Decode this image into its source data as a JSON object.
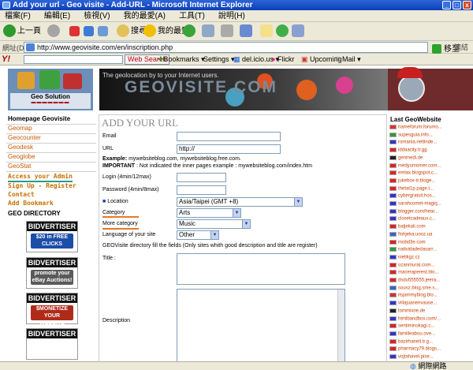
{
  "window": {
    "title": "Add your url - Geo visite - Add-URL - Microsoft Internet Explorer",
    "minimize": "_",
    "maximize": "□",
    "close": "x"
  },
  "menu": [
    "檔案(F)",
    "編輯(E)",
    "檢視(V)",
    "我的最愛(A)",
    "工具(T)",
    "說明(H)"
  ],
  "toolbar": {
    "back": "上一頁",
    "search": "搜尋",
    "favorites": "我的最愛"
  },
  "address": {
    "label": "網址(D)",
    "url": "http://www.geovisite.com/en/inscription.php",
    "go": "移至",
    "links": "連結"
  },
  "yahoo_bar": {
    "logo": "Y!",
    "search_button": "Web Search",
    "items": [
      "Bookmarks",
      "Settings",
      "del.icio.us",
      "Flickr",
      "Upcoming",
      "Mail"
    ]
  },
  "site": {
    "tagline": "The geolocation by to your Internet users.",
    "logo_text": "GEOVISITE.COM",
    "solution_caption": "Geo Solution"
  },
  "sidebar": {
    "section_title": "Homepage Geovisite",
    "nav": [
      "Geomap",
      "Geocounter",
      "Geodesk",
      "Geoglobe",
      "GeoStat"
    ],
    "account": [
      "Access your Admin",
      "Sign Up - Register",
      "Contact",
      "Add Bookmark"
    ],
    "directory_title": "GEO DIRECTORY",
    "ads": [
      {
        "brand": "BIDVERTISER",
        "line1": "$20 in FREE",
        "line2": "CLICKS",
        "color": "#1a4ea8"
      },
      {
        "brand": "BIDVERTISER",
        "line1": "promote your",
        "line2": "eBay Auctions!",
        "color": "#5a5a5a"
      },
      {
        "brand": "BIDVERTISER",
        "line1": "$MONETIZE",
        "line2": "YOUR WEBSITE",
        "color": "#b02a1a"
      },
      {
        "brand": "BIDVERTISER",
        "line1": "",
        "line2": "",
        "color": "#ffffff"
      }
    ]
  },
  "form": {
    "title": "ADD YOUR URL",
    "email_label": "Email",
    "email_value": "",
    "url_label": "URL",
    "url_value": "http://",
    "example_label": "Example:",
    "example_text": " mywebsiteblog.com, mywebsiteblog.free.com.",
    "important_label": "IMPORTANT",
    "important_text": " : Not indicated the inner pages example : mywebsiteblog.com/index.htm",
    "login_label": "Login (4min/12max)",
    "password_label": "Password (4min/8max)",
    "location_label": "Location",
    "location_value": "Asia/Taipei (GMT +8)",
    "category_label": "Category",
    "category_value": "Arts",
    "more_category_label": "More category",
    "more_category_value": "Music",
    "language_label": "Language of your site",
    "language_value": "Other",
    "directory_note": "GEOVisite directory fill the fields (Only sites whith good description and title are register)",
    "title_label": "Title :",
    "description_label": "Description"
  },
  "right": {
    "title": "Last GeoWebsite",
    "sites": [
      {
        "name": "nameforum.forumo...",
        "flag": "#d33"
      },
      {
        "name": "supesguia.info...",
        "flag": "#393"
      },
      {
        "name": "romania.netlinde...",
        "flag": "#33c"
      },
      {
        "name": "iddaacity.tr.gg",
        "flag": "#d22"
      },
      {
        "name": "genmedi.de",
        "flag": "#222"
      },
      {
        "name": "medyumomer.com...",
        "flag": "#d22"
      },
      {
        "name": "emlax.blogspot.c...",
        "flag": "#d22"
      },
      {
        "name": "jukebox-tr.bloge...",
        "flag": "#d22"
      },
      {
        "name": "thetat1p.page.t...",
        "flag": "#d22"
      },
      {
        "name": "cybergratuit.hos...",
        "flag": "#33c"
      },
      {
        "name": "sarahcomet-magiq...",
        "flag": "#33c"
      },
      {
        "name": "blogger.com/hear...",
        "flag": "#33c"
      },
      {
        "name": "closetcadeaux.c...",
        "flag": "#33c"
      },
      {
        "name": "baljekali.com",
        "flag": "#d22"
      },
      {
        "name": "fishjeka.uooz.ua",
        "flag": "#36c"
      },
      {
        "name": "mobd3e.com",
        "flag": "#d22"
      },
      {
        "name": "natividadedasarr...",
        "flag": "#393"
      },
      {
        "name": "nielikgz.cz",
        "flag": "#33c"
      },
      {
        "name": "ozanmurat.com...",
        "flag": "#d22"
      },
      {
        "name": "maceraperest.blo...",
        "flag": "#d22"
      },
      {
        "name": "dsdu555555.jeera...",
        "flag": "#d22"
      },
      {
        "name": "sousz.blog.sme.s...",
        "flag": "#36c"
      },
      {
        "name": "itsjammyblog.blo...",
        "flag": "#c33"
      },
      {
        "name": "villajuanenvause...",
        "flag": "#33c"
      },
      {
        "name": "tommixne.de",
        "flag": "#222"
      },
      {
        "name": "htmlbandbox.com/...",
        "flag": "#33c"
      },
      {
        "name": "sentiminokagi.c...",
        "flag": "#d22"
      },
      {
        "name": "familleabou.ove...",
        "flag": "#33c"
      },
      {
        "name": "bazirhaneli.tr.g...",
        "flag": "#d22"
      },
      {
        "name": "pharmacy79.blogs...",
        "flag": "#d22"
      },
      {
        "name": "vojtahavel.pise...",
        "flag": "#33c"
      },
      {
        "name": "klyuke/2010.word...",
        "flag": "#33c"
      }
    ]
  },
  "status": {
    "zone": "網際網路"
  }
}
